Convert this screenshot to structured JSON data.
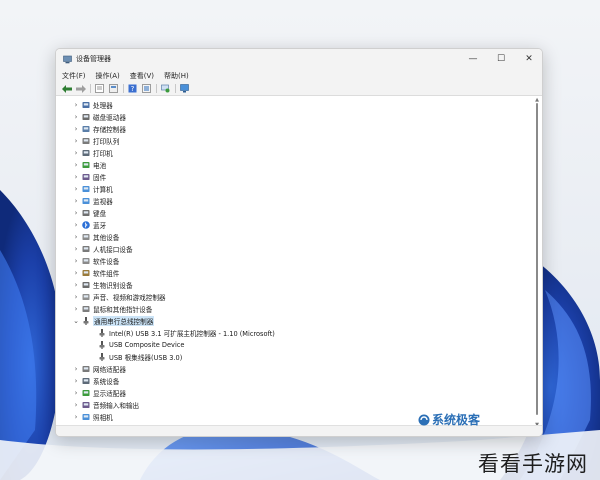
{
  "window": {
    "title": "设备管理器",
    "controls": {
      "minimize": "—",
      "maximize": "☐",
      "close": "✕"
    }
  },
  "menu": [
    "文件(F)",
    "操作(A)",
    "查看(V)",
    "帮助(H)"
  ],
  "toolbar": [
    "back-arrow-icon",
    "forward-arrow-icon",
    "properties-icon",
    "hardware-view-icon",
    "help-icon",
    "update-driver-icon",
    "scan-hardware-icon",
    "monitor-icon"
  ],
  "tree": [
    {
      "label": "处理器",
      "level": 0,
      "icon": "cpu-icon",
      "expanded": false
    },
    {
      "label": "磁盘驱动器",
      "level": 0,
      "icon": "disk-drive-icon",
      "expanded": false
    },
    {
      "label": "存储控制器",
      "level": 0,
      "icon": "storage-controller-icon",
      "expanded": false
    },
    {
      "label": "打印队列",
      "level": 0,
      "icon": "print-queue-icon",
      "expanded": false
    },
    {
      "label": "打印机",
      "level": 0,
      "icon": "printer-icon",
      "expanded": false
    },
    {
      "label": "电池",
      "level": 0,
      "icon": "battery-icon",
      "expanded": false
    },
    {
      "label": "固件",
      "level": 0,
      "icon": "firmware-icon",
      "expanded": false
    },
    {
      "label": "计算机",
      "level": 0,
      "icon": "computer-icon",
      "expanded": false
    },
    {
      "label": "监视器",
      "level": 0,
      "icon": "monitor-icon",
      "expanded": false
    },
    {
      "label": "键盘",
      "level": 0,
      "icon": "keyboard-icon",
      "expanded": false
    },
    {
      "label": "蓝牙",
      "level": 0,
      "icon": "bluetooth-icon",
      "expanded": false
    },
    {
      "label": "其他设备",
      "level": 0,
      "icon": "other-devices-icon",
      "expanded": false
    },
    {
      "label": "人机接口设备",
      "level": 0,
      "icon": "hid-icon",
      "expanded": false
    },
    {
      "label": "软件设备",
      "level": 0,
      "icon": "software-device-icon",
      "expanded": false
    },
    {
      "label": "软件组件",
      "level": 0,
      "icon": "software-component-icon",
      "expanded": false
    },
    {
      "label": "生物识别设备",
      "level": 0,
      "icon": "biometric-icon",
      "expanded": false
    },
    {
      "label": "声音、视频和游戏控制器",
      "level": 0,
      "icon": "sound-icon",
      "expanded": false
    },
    {
      "label": "鼠标和其他指针设备",
      "level": 0,
      "icon": "mouse-icon",
      "expanded": false
    },
    {
      "label": "通用串行总线控制器",
      "level": 0,
      "icon": "usb-icon",
      "expanded": true,
      "selected": true
    },
    {
      "label": "Intel(R) USB 3.1 可扩展主机控制器 - 1.10 (Microsoft)",
      "level": 1,
      "icon": "usb-icon"
    },
    {
      "label": "USB Composite Device",
      "level": 1,
      "icon": "usb-icon"
    },
    {
      "label": "USB 根集线器(USB 3.0)",
      "level": 1,
      "icon": "usb-icon"
    },
    {
      "label": "网络适配器",
      "level": 0,
      "icon": "network-adapter-icon",
      "expanded": false
    },
    {
      "label": "系统设备",
      "level": 0,
      "icon": "system-device-icon",
      "expanded": false
    },
    {
      "label": "显示适配器",
      "level": 0,
      "icon": "display-adapter-icon",
      "expanded": false
    },
    {
      "label": "音频输入和输出",
      "level": 0,
      "icon": "audio-io-icon",
      "expanded": false
    },
    {
      "label": "照相机",
      "level": 0,
      "icon": "camera-icon",
      "expanded": false
    }
  ],
  "watermarks": {
    "brand1": "系统极客",
    "brand2": "看看手游网"
  },
  "colors": {
    "selection": "#cce4f7",
    "accent": "#0067c0"
  }
}
